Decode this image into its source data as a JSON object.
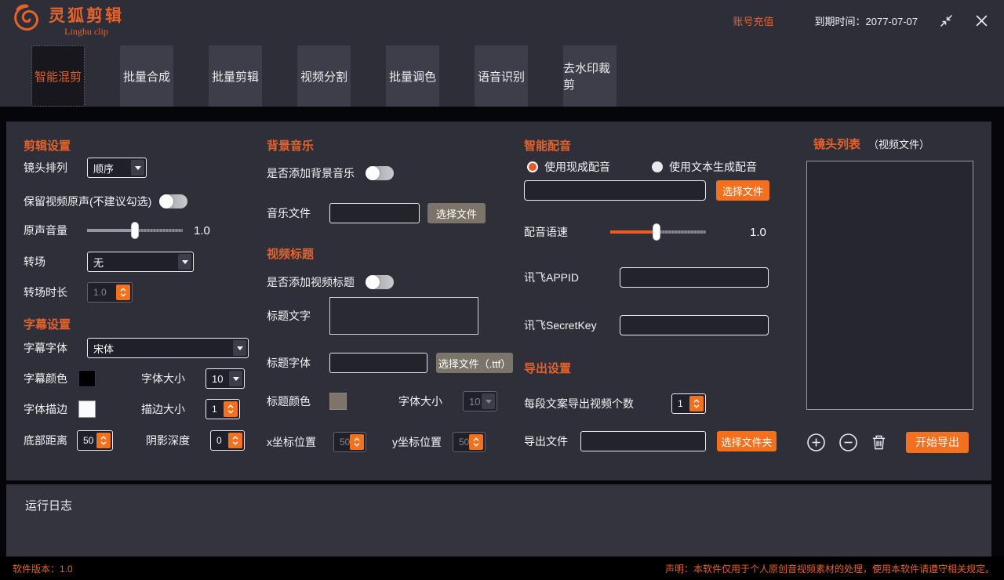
{
  "colors": {
    "accent": "#ED6A2E",
    "button_orange": "#F3701E",
    "button_gray": "#7B7469",
    "panel": "#2F2F3A",
    "background": "#2E2E38",
    "black": "#06060A"
  },
  "icons": {
    "logo": "fox-swirl-logo",
    "collapse": "collapse-window-icon",
    "close": "close-icon",
    "add": "plus-circle-icon",
    "remove": "minus-circle-icon",
    "delete": "trash-icon"
  },
  "titlebar": {
    "app_name": "灵狐剪辑",
    "app_subtitle": "Linghu clip",
    "recharge": "账号充值",
    "expire": "到期时间：2077-07-07"
  },
  "tabs": [
    "智能混剪",
    "批量合成",
    "批量剪辑",
    "视频分割",
    "批量调色",
    "语音识别",
    "去水印裁剪"
  ],
  "edit": {
    "title": "剪辑设置",
    "shot_order_label": "镜头排列",
    "shot_order_value": "顺序",
    "keep_audio_label": "保留视频原声(不建议勾选)",
    "volume_label": "原声音量",
    "volume_value": "1.0",
    "transition_label": "转场",
    "transition_value": "无",
    "transition_duration_label": "转场时长",
    "transition_duration_value": "1.0"
  },
  "subtitle": {
    "title": "字幕设置",
    "font_label": "字幕字体",
    "font_value": "宋体",
    "color_label": "字幕颜色",
    "size_label": "字体大小",
    "size_value": "10",
    "stroke_label": "字体描边",
    "stroke_size_label": "描边大小",
    "stroke_size_value": "1",
    "bottom_label": "底部距离",
    "bottom_value": "50",
    "shadow_label": "阴影深度",
    "shadow_value": "0"
  },
  "bgm": {
    "title": "背景音乐",
    "add_label": "是否添加背景音乐",
    "file_label": "音乐文件",
    "file_value": "",
    "choose_button": "选择文件"
  },
  "video_title": {
    "title": "视频标题",
    "add_label": "是否添加视频标题",
    "text_label": "标题文字",
    "text_value": "",
    "font_label": "标题字体",
    "font_value": "",
    "choose_button": "选择文件（.ttf）",
    "color_label": "标题颜色",
    "size_label": "字体大小",
    "size_value": "10",
    "x_label": "x坐标位置",
    "x_value": "50",
    "y_label": "y坐标位置",
    "y_value": "50"
  },
  "dubbing": {
    "title": "智能配音",
    "radio_existing": "使用现成配音",
    "radio_generate": "使用文本生成配音",
    "file_value": "",
    "choose_button": "选择文件",
    "speed_label": "配音语速",
    "speed_value": "1.0",
    "appid_label": "讯飞APPID",
    "appid_value": "",
    "secret_label": "讯飞SecretKey",
    "secret_value": ""
  },
  "export": {
    "title": "导出设置",
    "count_label": "每段文案导出视频个数",
    "count_value": "1",
    "file_label": "导出文件",
    "file_value": "",
    "choose_button": "选择文件夹"
  },
  "shot_list": {
    "title": "镜头列表",
    "subtitle": "（视频文件）",
    "start_button": "开始导出"
  },
  "log": {
    "title": "运行日志"
  },
  "statusbar": {
    "version": "软件版本：1.0",
    "notice": "声明：本软件仅用于个人原创音视频素材的处理，使用本软件请遵守相关规定。"
  }
}
